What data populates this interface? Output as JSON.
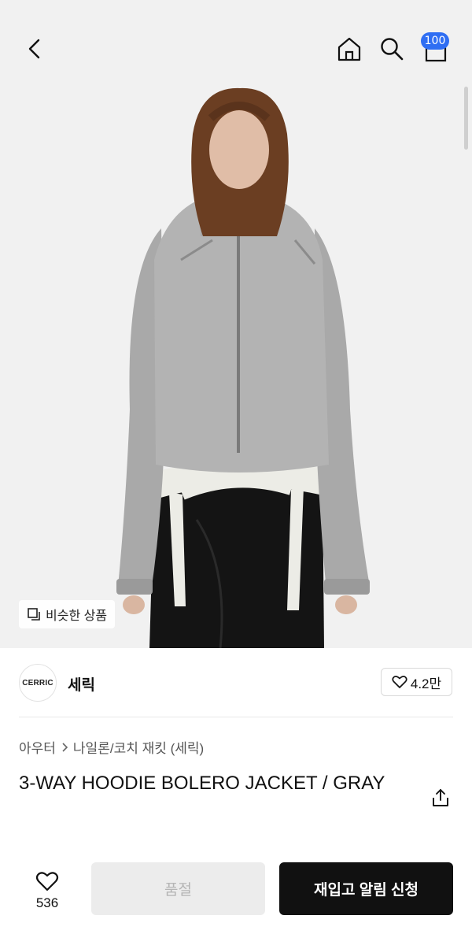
{
  "header": {
    "back_icon": "chevron-left-icon",
    "home_icon": "home-icon",
    "search_icon": "search-icon",
    "cart_icon": "cart-icon",
    "cart_badge": "100",
    "badge_color": "#2f6ef3"
  },
  "hero": {
    "similar_products_label": "비슷한 상품",
    "similar_icon": "similar-squares-icon"
  },
  "brand": {
    "logo_text": "CERRIC",
    "name": "세릭",
    "likes": "4.2만"
  },
  "product": {
    "breadcrumb": [
      "아우터",
      "나일론/코치 재킷 (세릭)"
    ],
    "title": "3-WAY HOODIE BOLERO JACKET / GRAY"
  },
  "bottom": {
    "like_count": "536",
    "soldout_label": "품절",
    "restock_label": "재입고 알림 신청"
  }
}
